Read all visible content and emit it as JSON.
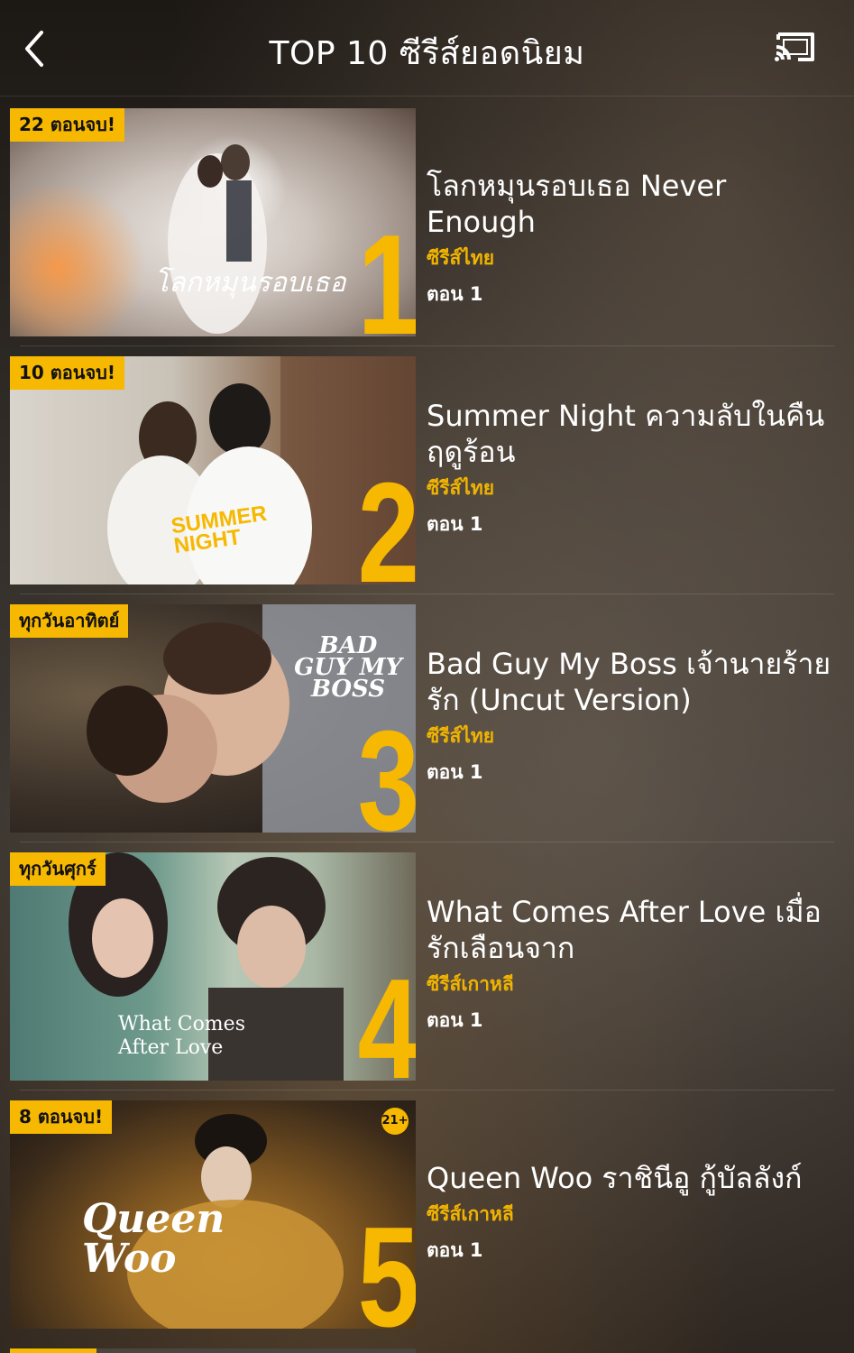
{
  "header": {
    "title": "TOP 10 ซีรีส์ยอดนิยม",
    "back_icon": "chevron-left-icon",
    "cast_icon": "cast-icon"
  },
  "colors": {
    "accent": "#f6b800",
    "category_text": "#f0b400"
  },
  "items": [
    {
      "rank": "1",
      "badge": "22 ตอนจบ!",
      "title": "โลกหมุนรอบเธอ Never Enough",
      "category": "ซีรีส์ไทย",
      "episode": "ตอน 1",
      "logo": "โลกหมุนรอบเธอ"
    },
    {
      "rank": "2",
      "badge": "10 ตอนจบ!",
      "title": "Summer Night ความลับในคืนฤดูร้อน",
      "category": "ซีรีส์ไทย",
      "episode": "ตอน 1",
      "logo": "SUMMER NIGHT"
    },
    {
      "rank": "3",
      "badge": "ทุกวันอาทิตย์",
      "title": "Bad Guy My Boss เจ้านายร้ายรัก (Uncut Version)",
      "category": "ซีรีส์ไทย",
      "episode": "ตอน 1",
      "logo": "BAD GUY MY BOSS"
    },
    {
      "rank": "4",
      "badge": "ทุกวันศุกร์",
      "title": "What Comes After Love เมื่อรักเลือนจาก",
      "category": "ซีรีส์เกาหลี",
      "episode": "ตอน 1",
      "logo": "What Comes After Love"
    },
    {
      "rank": "5",
      "badge": "8 ตอนจบ!",
      "title": "Queen Woo ราชินีอู กู้บัลลังก์",
      "category": "ซีรีส์เกาหลี",
      "episode": "ตอน 1",
      "logo": "Queen Woo",
      "age_rating": "21+"
    }
  ]
}
